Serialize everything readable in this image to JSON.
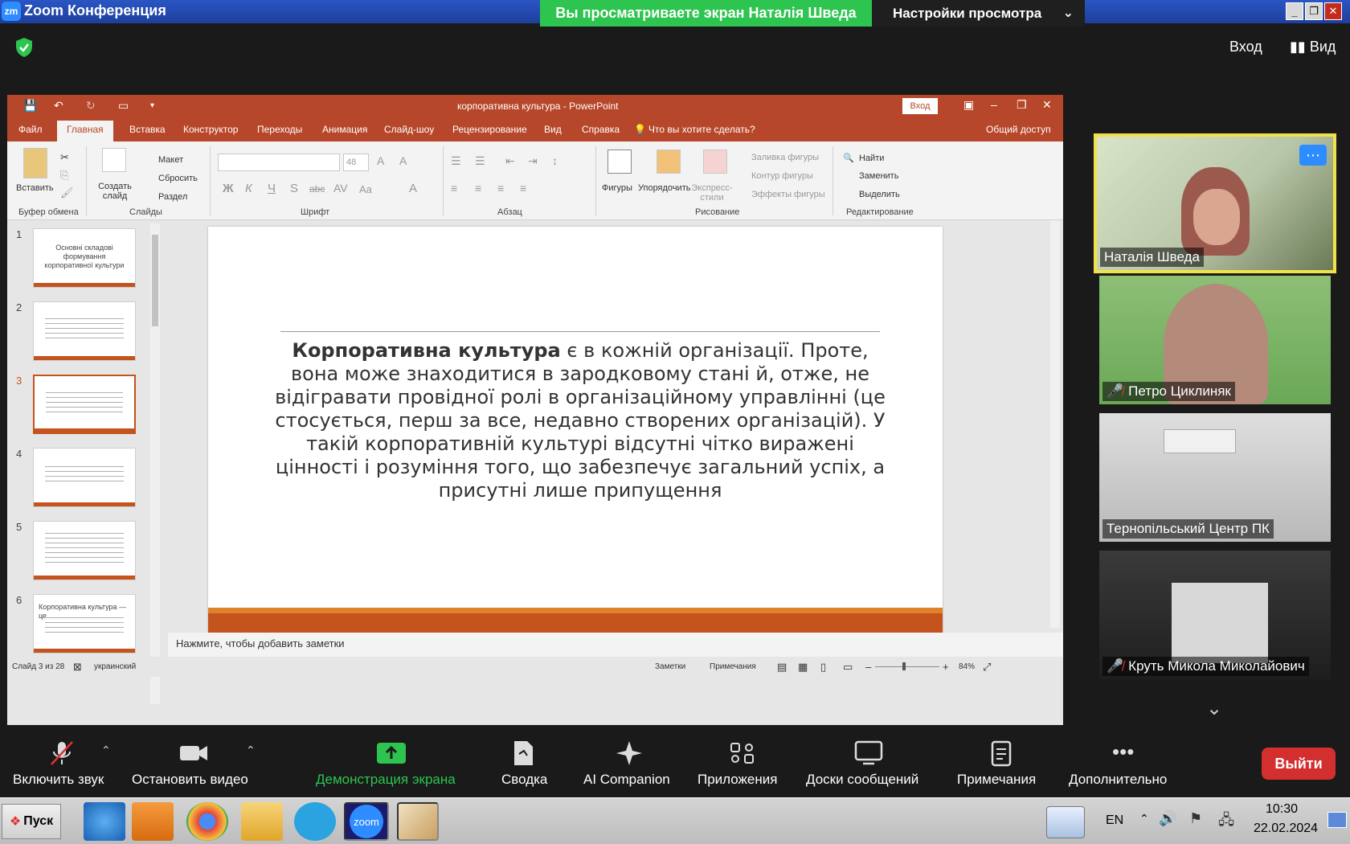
{
  "window": {
    "app_title": "Zoom Конференция",
    "logo": "zm"
  },
  "share_banner": {
    "text": "Вы просматриваете экран Наталія Шведа",
    "settings": "Настройки просмотра"
  },
  "topbar": {
    "enter": "Вход",
    "view": "Вид"
  },
  "ppt": {
    "title": "корпоративна культура - PowerPoint",
    "login": "Вход",
    "tabs": [
      "Файл",
      "Главная",
      "Вставка",
      "Конструктор",
      "Переходы",
      "Анимация",
      "Слайд-шоу",
      "Рецензирование",
      "Вид",
      "Справка"
    ],
    "tell_me": "Что вы хотите сделать?",
    "share": "Общий доступ",
    "ribbon": {
      "paste": "Вставить",
      "new_slide": "Создать слайд",
      "layout": "Макет",
      "reset": "Сбросить",
      "section": "Раздел",
      "font_size": "48",
      "shapes": "Фигуры",
      "arrange": "Упорядочить",
      "express": "Экспресс-стили",
      "fill": "Заливка фигуры",
      "outline": "Контур фигуры",
      "effects": "Эффекты фигуры",
      "find": "Найти",
      "replace": "Заменить",
      "select": "Выделить",
      "groups": [
        "Буфер обмена",
        "Слайды",
        "Шрифт",
        "Абзац",
        "Рисование",
        "Редактирование"
      ]
    },
    "thumbnails": [
      {
        "num": "1",
        "text": "Основні складові формування корпоративної культури"
      },
      {
        "num": "2",
        "text": ""
      },
      {
        "num": "3",
        "text": ""
      },
      {
        "num": "4",
        "text": ""
      },
      {
        "num": "5",
        "text": ""
      },
      {
        "num": "6",
        "text": "Корпоративна культура — це"
      }
    ],
    "slide": {
      "bold": "Корпоративна культура",
      "text": " є в кожній організації. Проте, вона може знаходитися в зародковому стані й, отже, не відігравати провідної ролі в організаційному управлінні (це стосується, перш за все, недавно створених організацій). У такій корпоративній культурі відсутні чітко виражені цінності і розуміння того, що забезпечує загальний успіх, а присутні лише припущення"
    },
    "notes": "Нажмите, чтобы добавить заметки",
    "status": {
      "slide": "Слайд 3 из 28",
      "lang": "украинский",
      "notes": "Заметки",
      "comments": "Примечания",
      "zoom": "84%"
    }
  },
  "participants": [
    {
      "name": "Наталія Шведа"
    },
    {
      "name": "Петро Циклиняк"
    },
    {
      "name": "Тернопільський Центр ПК"
    },
    {
      "name": "Круть Микола Миколайович"
    }
  ],
  "toolbar": {
    "mute": "Включить звук",
    "video": "Остановить видео",
    "share": "Демонстрация экрана",
    "summary": "Сводка",
    "ai": "AI Companion",
    "apps": "Приложения",
    "boards": "Доски сообщений",
    "notes": "Примечания",
    "more": "Дополнительно",
    "leave": "Выйти"
  },
  "taskbar": {
    "start": "Пуск",
    "lang": "EN",
    "time": "10:30",
    "date": "22.02.2024",
    "zoom_label": "zoom"
  },
  "colors": {
    "accent_green": "#2dc44f",
    "ppt_orange": "#b7472a",
    "slide_orange": "#c4531d",
    "zoom_blue": "#2d8cff",
    "leave_red": "#d32f2f"
  }
}
